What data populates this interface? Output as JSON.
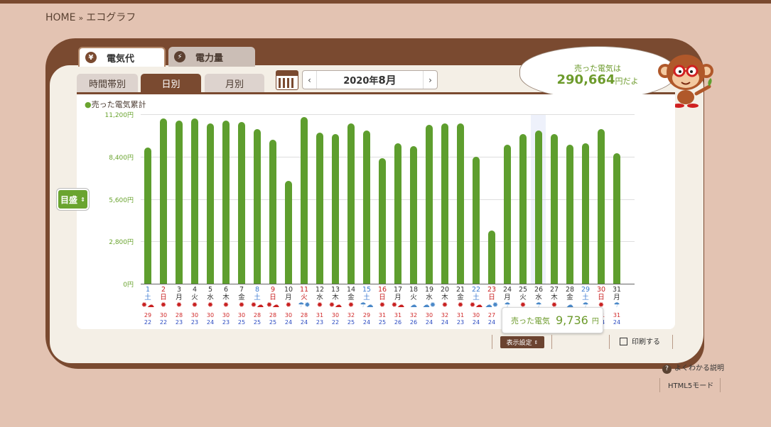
{
  "breadcrumb": {
    "home": "HOME",
    "sep": "»",
    "current": "エコグラフ"
  },
  "tabs": [
    {
      "label": "電気代",
      "icon": "yen-icon",
      "glyph": "¥"
    },
    {
      "label": "電力量",
      "icon": "bolt-icon",
      "glyph": "⚡"
    }
  ],
  "period_tabs": [
    "時間帯別",
    "日別",
    "月別"
  ],
  "date_nav": {
    "year": "2020年",
    "month": "8月",
    "prev": "‹",
    "next": "›"
  },
  "bubble": {
    "line1": "売った電気は",
    "amount": "290,664",
    "suffix": "円だよ"
  },
  "legend": "売った電気累計",
  "scale_button": "目盛",
  "tooltip": {
    "label": "売った電気",
    "value": "9,736",
    "unit": "円"
  },
  "display_settings": "表示設定",
  "print_label": "印刷する",
  "howto_label": "よくわかる説明",
  "html5_label": "HTML5モード",
  "colors": {
    "bar": "#5e9e2e",
    "frame": "#7a4a30",
    "weekday": "#333333",
    "saturday": "#3a78d0",
    "sunday_holiday": "#c82020"
  },
  "chart_data": {
    "type": "bar",
    "title": "",
    "series": [
      {
        "name": "売った電気累計",
        "values": [
          9000,
          10900,
          10800,
          10900,
          10600,
          10800,
          10700,
          10200,
          9500,
          6800,
          11000,
          10000,
          9900,
          10600,
          10100,
          8300,
          9300,
          9100,
          10500,
          10600,
          10600,
          8400,
          3500,
          9200,
          9900,
          10100,
          9900,
          9200,
          9300,
          10200,
          8600
        ]
      }
    ],
    "ylim": [
      0,
      11200
    ],
    "yticks": [
      "0円",
      "2,800円",
      "5,600円",
      "8,400円",
      "11,200円"
    ],
    "days": [
      {
        "d": "1",
        "w": "土",
        "type": "sat",
        "wx": "sun-cloud",
        "hi": "29",
        "lo": "22"
      },
      {
        "d": "2",
        "w": "日",
        "type": "sun",
        "wx": "sun",
        "hi": "30",
        "lo": "22"
      },
      {
        "d": "3",
        "w": "月",
        "type": "wd",
        "wx": "sun",
        "hi": "28",
        "lo": "23"
      },
      {
        "d": "4",
        "w": "火",
        "type": "wd",
        "wx": "sun",
        "hi": "30",
        "lo": "23"
      },
      {
        "d": "5",
        "w": "水",
        "type": "wd",
        "wx": "sun",
        "hi": "30",
        "lo": "24"
      },
      {
        "d": "6",
        "w": "木",
        "type": "wd",
        "wx": "sun",
        "hi": "30",
        "lo": "23"
      },
      {
        "d": "7",
        "w": "金",
        "type": "wd",
        "wx": "sun",
        "hi": "30",
        "lo": "25"
      },
      {
        "d": "8",
        "w": "土",
        "type": "sat",
        "wx": "sun-cloud",
        "hi": "28",
        "lo": "25"
      },
      {
        "d": "9",
        "w": "日",
        "type": "sun",
        "wx": "sun-cloud",
        "hi": "28",
        "lo": "25"
      },
      {
        "d": "10",
        "w": "月",
        "type": "wd",
        "wx": "sun",
        "hi": "30",
        "lo": "24"
      },
      {
        "d": "11",
        "w": "火",
        "type": "sun",
        "wx": "umbrella-sun",
        "hi": "28",
        "lo": "24"
      },
      {
        "d": "12",
        "w": "水",
        "type": "wd",
        "wx": "sun",
        "hi": "31",
        "lo": "23"
      },
      {
        "d": "13",
        "w": "木",
        "type": "wd",
        "wx": "sun-cloud",
        "hi": "30",
        "lo": "22"
      },
      {
        "d": "14",
        "w": "金",
        "type": "wd",
        "wx": "sun",
        "hi": "32",
        "lo": "25"
      },
      {
        "d": "15",
        "w": "土",
        "type": "sat",
        "wx": "umbrella-cloud",
        "hi": "29",
        "lo": "24"
      },
      {
        "d": "16",
        "w": "日",
        "type": "sun",
        "wx": "sun",
        "hi": "31",
        "lo": "25"
      },
      {
        "d": "17",
        "w": "月",
        "type": "wd",
        "wx": "sun-cloud",
        "hi": "31",
        "lo": "26"
      },
      {
        "d": "18",
        "w": "火",
        "type": "wd",
        "wx": "cloud",
        "hi": "32",
        "lo": "26"
      },
      {
        "d": "19",
        "w": "水",
        "type": "wd",
        "wx": "cloud-sun",
        "hi": "30",
        "lo": "24"
      },
      {
        "d": "20",
        "w": "木",
        "type": "wd",
        "wx": "sun",
        "hi": "32",
        "lo": "24"
      },
      {
        "d": "21",
        "w": "金",
        "type": "wd",
        "wx": "sun",
        "hi": "31",
        "lo": "23"
      },
      {
        "d": "22",
        "w": "土",
        "type": "sat",
        "wx": "sun-cloud",
        "hi": "30",
        "lo": "24"
      },
      {
        "d": "23",
        "w": "日",
        "type": "sun",
        "wx": "cloud-sun",
        "hi": "27",
        "lo": "24"
      },
      {
        "d": "24",
        "w": "月",
        "type": "wd",
        "wx": "umbrella",
        "hi": "",
        "lo": ""
      },
      {
        "d": "25",
        "w": "火",
        "type": "wd",
        "wx": "sun",
        "hi": "",
        "lo": ""
      },
      {
        "d": "26",
        "w": "水",
        "type": "wd",
        "wx": "umbrella",
        "hi": "",
        "lo": ""
      },
      {
        "d": "27",
        "w": "木",
        "type": "wd",
        "wx": "sun",
        "hi": "",
        "lo": ""
      },
      {
        "d": "28",
        "w": "金",
        "type": "wd",
        "wx": "cloud",
        "hi": "",
        "lo": ""
      },
      {
        "d": "29",
        "w": "土",
        "type": "sat",
        "wx": "umbrella",
        "hi": "",
        "lo": ""
      },
      {
        "d": "30",
        "w": "日",
        "type": "sun",
        "wx": "sun",
        "hi": "31",
        "lo": "24"
      },
      {
        "d": "31",
        "w": "月",
        "type": "wd",
        "wx": "umbrella",
        "hi": "31",
        "lo": "24"
      }
    ]
  }
}
